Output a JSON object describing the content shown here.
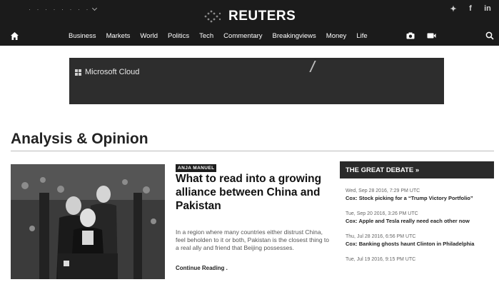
{
  "header": {
    "edition": "· ·  · · · · · ·",
    "logo_text": "REUTERS",
    "social": [
      "twitter-icon",
      "facebook-icon",
      "linkedin-icon"
    ],
    "social_glyphs": [
      "✦",
      "f",
      "in"
    ]
  },
  "nav": {
    "items": [
      "Business",
      "Markets",
      "World",
      "Politics",
      "Tech",
      "Commentary",
      "Breakingviews",
      "Money",
      "Life"
    ]
  },
  "ad": {
    "brand": "Microsoft Cloud"
  },
  "section": {
    "title": "Analysis & Opinion"
  },
  "feature": {
    "author": "ANJA MANUEL",
    "headline": "What to read into a growing alliance between China and Pakistan",
    "teaser": "In a region where many countries either distrust China, feel beholden to it or both, Pakistan is the closest thing to a real ally and friend that Beijing possesses.",
    "continue_label": "Continue Reading",
    "continue_suffix": " ."
  },
  "debate": {
    "heading": "THE GREAT DEBATE »",
    "items": [
      {
        "date": "Wed, Sep 28 2016, 7:29 PM UTC",
        "title": "Cox: Stock picking for a “Trump Victory Portfolio”"
      },
      {
        "date": "Tue, Sep 20 2016, 3:26 PM UTC",
        "title": "Cox: Apple and Tesla really need each other now"
      },
      {
        "date": "Thu, Jul 28 2016, 6:56 PM UTC",
        "title": "Cox: Banking ghosts haunt Clinton in Philadelphia"
      },
      {
        "date": "Tue, Jul 19 2016, 9:15 PM UTC",
        "title": ""
      }
    ]
  },
  "colors": {
    "topbar": "#1b1b1b",
    "ad_background": "#2d2d2d",
    "debate_header": "#2a2a2a"
  }
}
